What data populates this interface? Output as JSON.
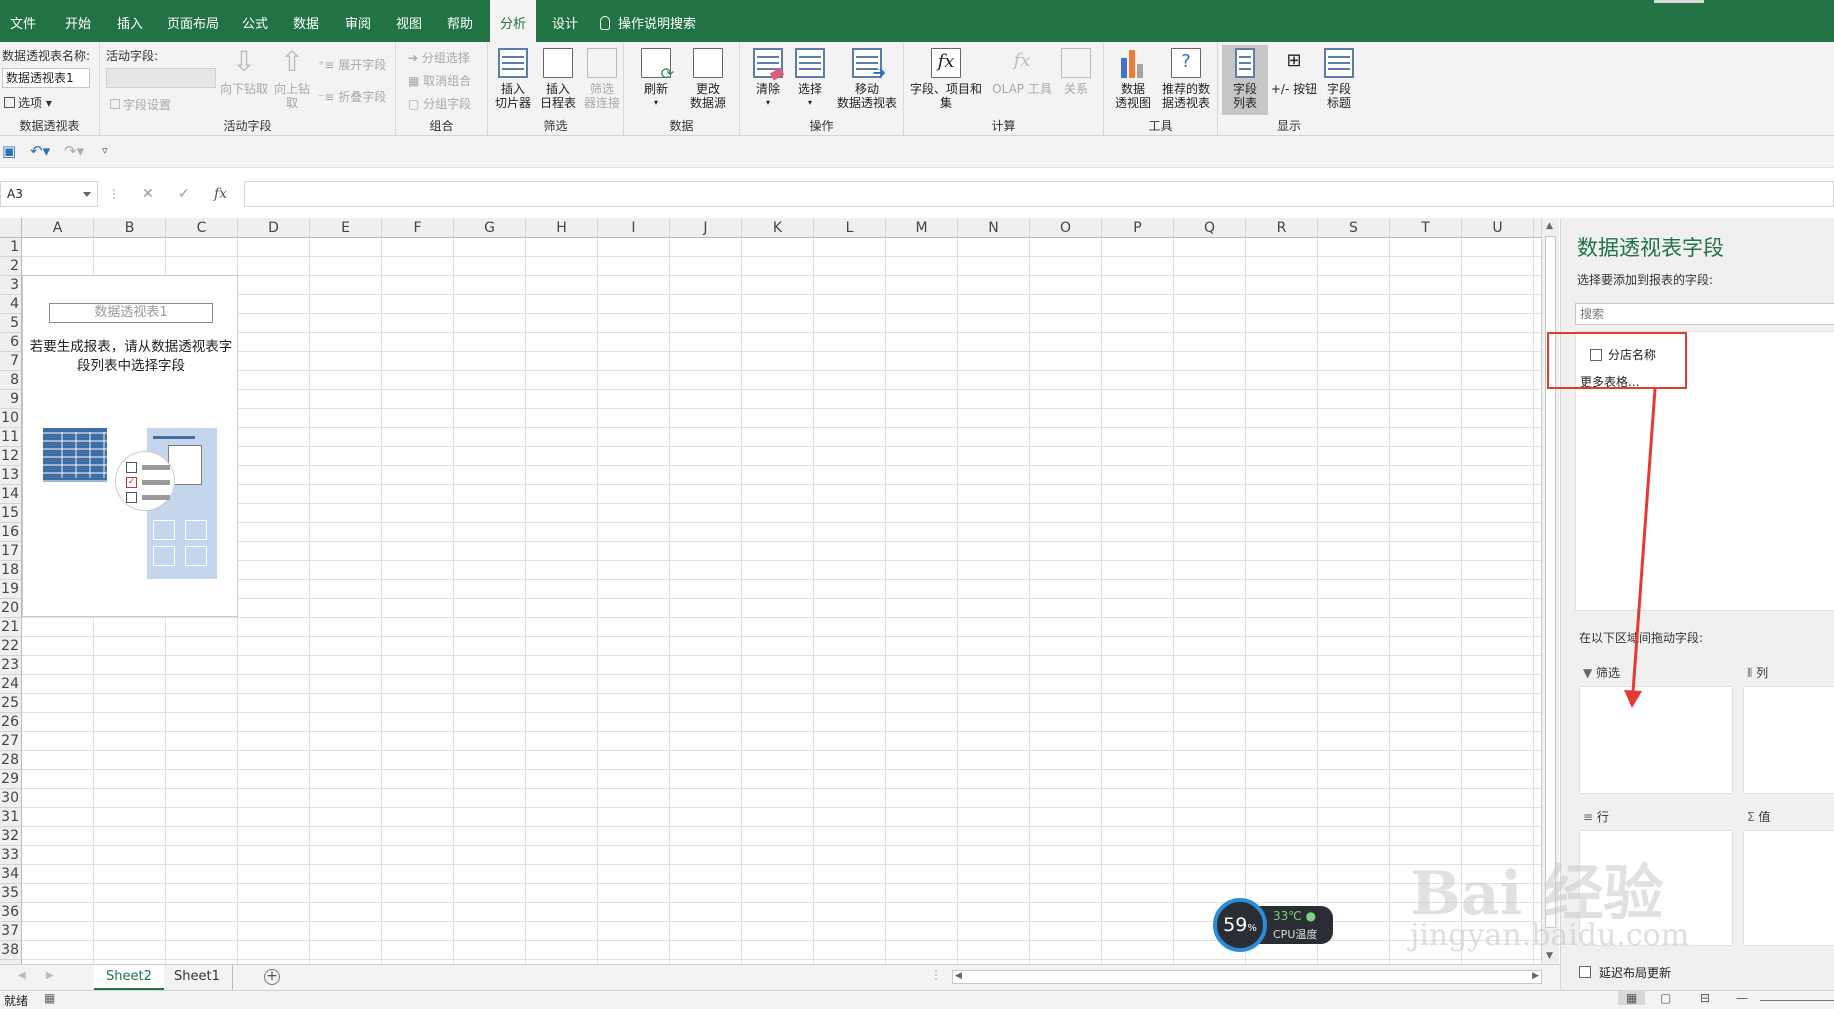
{
  "tabs": [
    "文件",
    "开始",
    "插入",
    "页面布局",
    "公式",
    "数据",
    "审阅",
    "视图",
    "帮助",
    "分析",
    "设计"
  ],
  "active_tab": "分析",
  "tell_me": "操作说明搜索",
  "ribbon": {
    "pt_name_label": "数据透视表名称:",
    "pt_name_value": "数据透视表1",
    "options": "选项",
    "group_pt": "数据透视表",
    "active_field_label": "活动字段:",
    "field_settings": "字段设置",
    "drill_down": "向下钻取",
    "drill_up": "向上钻\n取",
    "expand_field": "展开字段",
    "collapse_field": "折叠字段",
    "group_active_field": "活动字段",
    "group_selection": "分组选择",
    "ungroup": "取消组合",
    "group_field": "分组字段",
    "group_group": "组合",
    "insert_slicer": "插入\n切片器",
    "insert_timeline": "插入\n日程表",
    "filter_conn": "筛选\n器连接",
    "group_filter": "筛选",
    "refresh": "刷新",
    "change_source": "更改\n数据源",
    "group_data": "数据",
    "clear": "清除",
    "select": "选择",
    "move_pt": "移动\n数据透视表",
    "group_actions": "操作",
    "fields_items": "字段、项目和\n集",
    "olap_tools": "OLAP 工具",
    "relationships": "关系",
    "group_calc": "计算",
    "pivot_chart": "数据\n透视图",
    "recommended": "推荐的数\n据透视表",
    "group_tools": "工具",
    "field_list": "字段\n列表",
    "plus_minus": "+/- 按钮",
    "field_headers": "字段\n标题",
    "group_show": "显示"
  },
  "namebox": "A3",
  "formula_fx": "fx",
  "columns": [
    "A",
    "B",
    "C",
    "D",
    "E",
    "F",
    "G",
    "H",
    "I",
    "J",
    "K",
    "L",
    "M",
    "N",
    "O",
    "P",
    "Q",
    "R",
    "S",
    "T",
    "U"
  ],
  "rows": [
    "1",
    "2",
    "3",
    "4",
    "5",
    "6",
    "7",
    "8",
    "9",
    "10",
    "11",
    "12",
    "13",
    "14",
    "15",
    "16",
    "17",
    "18",
    "19",
    "20",
    "21",
    "22",
    "23",
    "24",
    "25",
    "26",
    "27",
    "28",
    "29",
    "30",
    "31",
    "32",
    "33",
    "34",
    "35",
    "36",
    "37",
    "38"
  ],
  "pivot_placeholder": {
    "name": "数据透视表1",
    "message": "若要生成报表，请从数据透视表字段列表中选择字段"
  },
  "sheets": [
    "Sheet2",
    "Sheet1"
  ],
  "active_sheet": "Sheet2",
  "status_text": "就绪",
  "pane": {
    "title": "数据透视表字段",
    "subtitle": "选择要添加到报表的字段:",
    "search_placeholder": "搜索",
    "field": "分店名称",
    "more_tables": "更多表格...",
    "drag_hint": "在以下区域间拖动字段:",
    "filters": "筛选",
    "columns": "列",
    "rows": "行",
    "values": "值",
    "defer": "延迟布局更新"
  },
  "cpu": {
    "percent": "59",
    "percent_sign": "%",
    "temp": "33℃",
    "label": "CPU温度"
  },
  "watermark": {
    "brand": "Bai  经验",
    "url": "jingyan.baidu.com"
  },
  "colors": {
    "accent": "#217346",
    "annotation": "#e53935"
  }
}
